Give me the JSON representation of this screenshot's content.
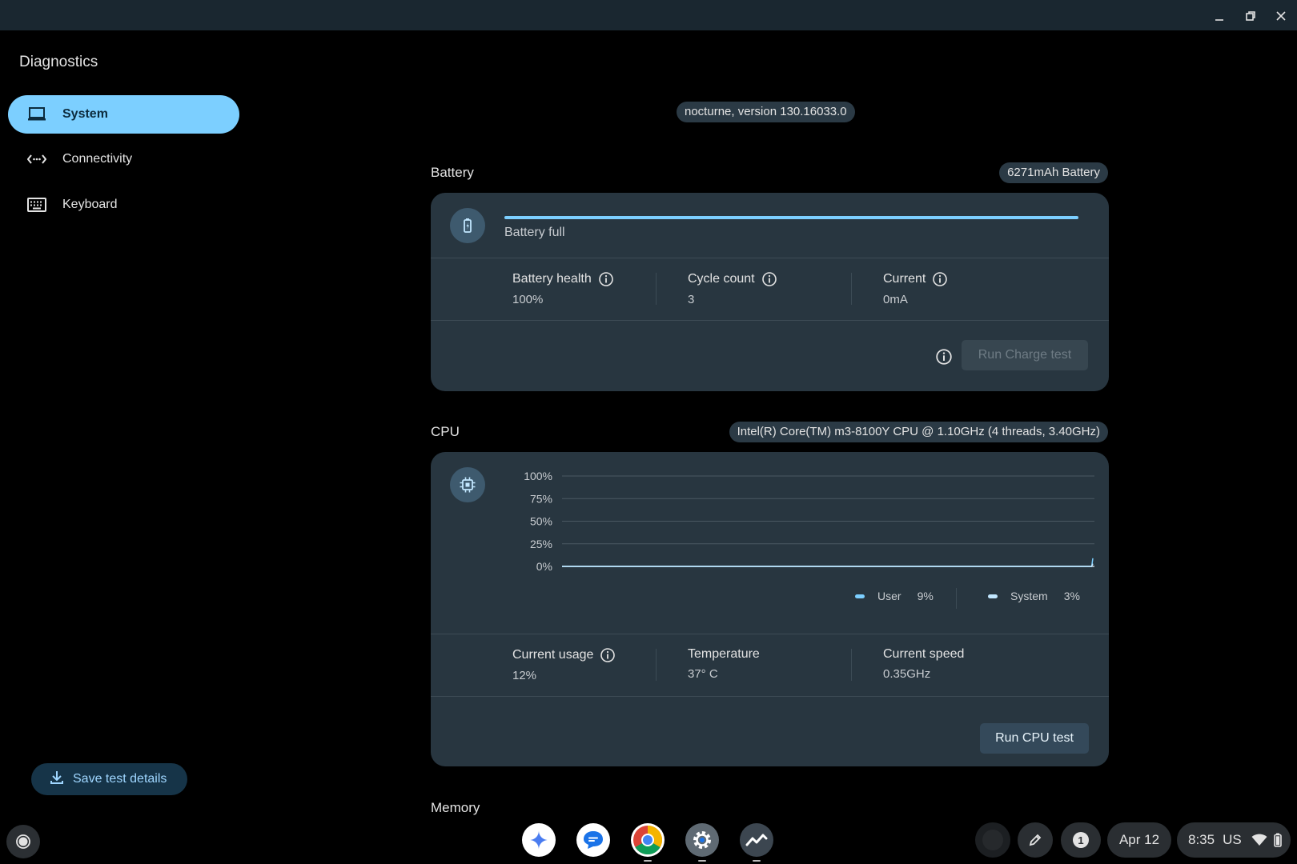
{
  "window": {
    "minimize_icon": "minimize-icon",
    "restore_icon": "restore-icon",
    "close_icon": "close-icon"
  },
  "app_title": "Diagnostics",
  "nav": [
    {
      "label": "System",
      "icon": "laptop-icon",
      "active": true
    },
    {
      "label": "Connectivity",
      "icon": "connectivity-icon",
      "active": false
    },
    {
      "label": "Keyboard",
      "icon": "keyboard-icon",
      "active": false
    }
  ],
  "save_button": "Save test details",
  "version": "nocturne, version 130.16033.0",
  "battery": {
    "title": "Battery",
    "chip": "6271mAh Battery",
    "status": "Battery full",
    "charge_fraction": 1.0,
    "metrics": [
      {
        "label": "Battery health",
        "value": "100%"
      },
      {
        "label": "Cycle count",
        "value": "3"
      },
      {
        "label": "Current",
        "value": "0mA"
      }
    ],
    "run_button": "Run Charge test"
  },
  "cpu": {
    "title": "CPU",
    "chip": "Intel(R) Core(TM) m3-8100Y CPU @ 1.10GHz (4 threads, 3.40GHz)",
    "legend": [
      {
        "name": "User",
        "value": "9%",
        "color": "#7ccfff"
      },
      {
        "name": "System",
        "value": "3%",
        "color": "#c2e7ff"
      }
    ],
    "metrics": [
      {
        "label": "Current usage",
        "value": "12%"
      },
      {
        "label": "Temperature",
        "value": "37° C"
      },
      {
        "label": "Current speed",
        "value": "0.35GHz"
      }
    ],
    "run_button": "Run CPU test"
  },
  "chart_data": {
    "type": "line",
    "y_ticks": [
      "100%",
      "75%",
      "50%",
      "25%",
      "0%"
    ],
    "ylim": [
      0,
      100
    ],
    "series": [
      {
        "name": "User",
        "values": [
          0,
          0,
          0,
          0,
          0,
          0,
          0,
          0,
          0,
          0,
          0,
          0,
          0,
          0,
          0,
          0,
          0,
          0,
          0,
          0,
          9
        ]
      },
      {
        "name": "System",
        "values": [
          0,
          0,
          0,
          0,
          0,
          0,
          0,
          0,
          0,
          0,
          0,
          0,
          0,
          0,
          0,
          0,
          0,
          0,
          0,
          0,
          3
        ]
      }
    ]
  },
  "memory": {
    "title": "Memory"
  },
  "shelf": {
    "apps": [
      {
        "name": "gemini-app-icon"
      },
      {
        "name": "messages-app-icon"
      },
      {
        "name": "chrome-app-icon"
      },
      {
        "name": "settings-app-icon"
      },
      {
        "name": "diagnostics-app-icon"
      }
    ],
    "notification_count": "1",
    "date": "Apr 12",
    "time": "8:35",
    "locale": "US"
  }
}
